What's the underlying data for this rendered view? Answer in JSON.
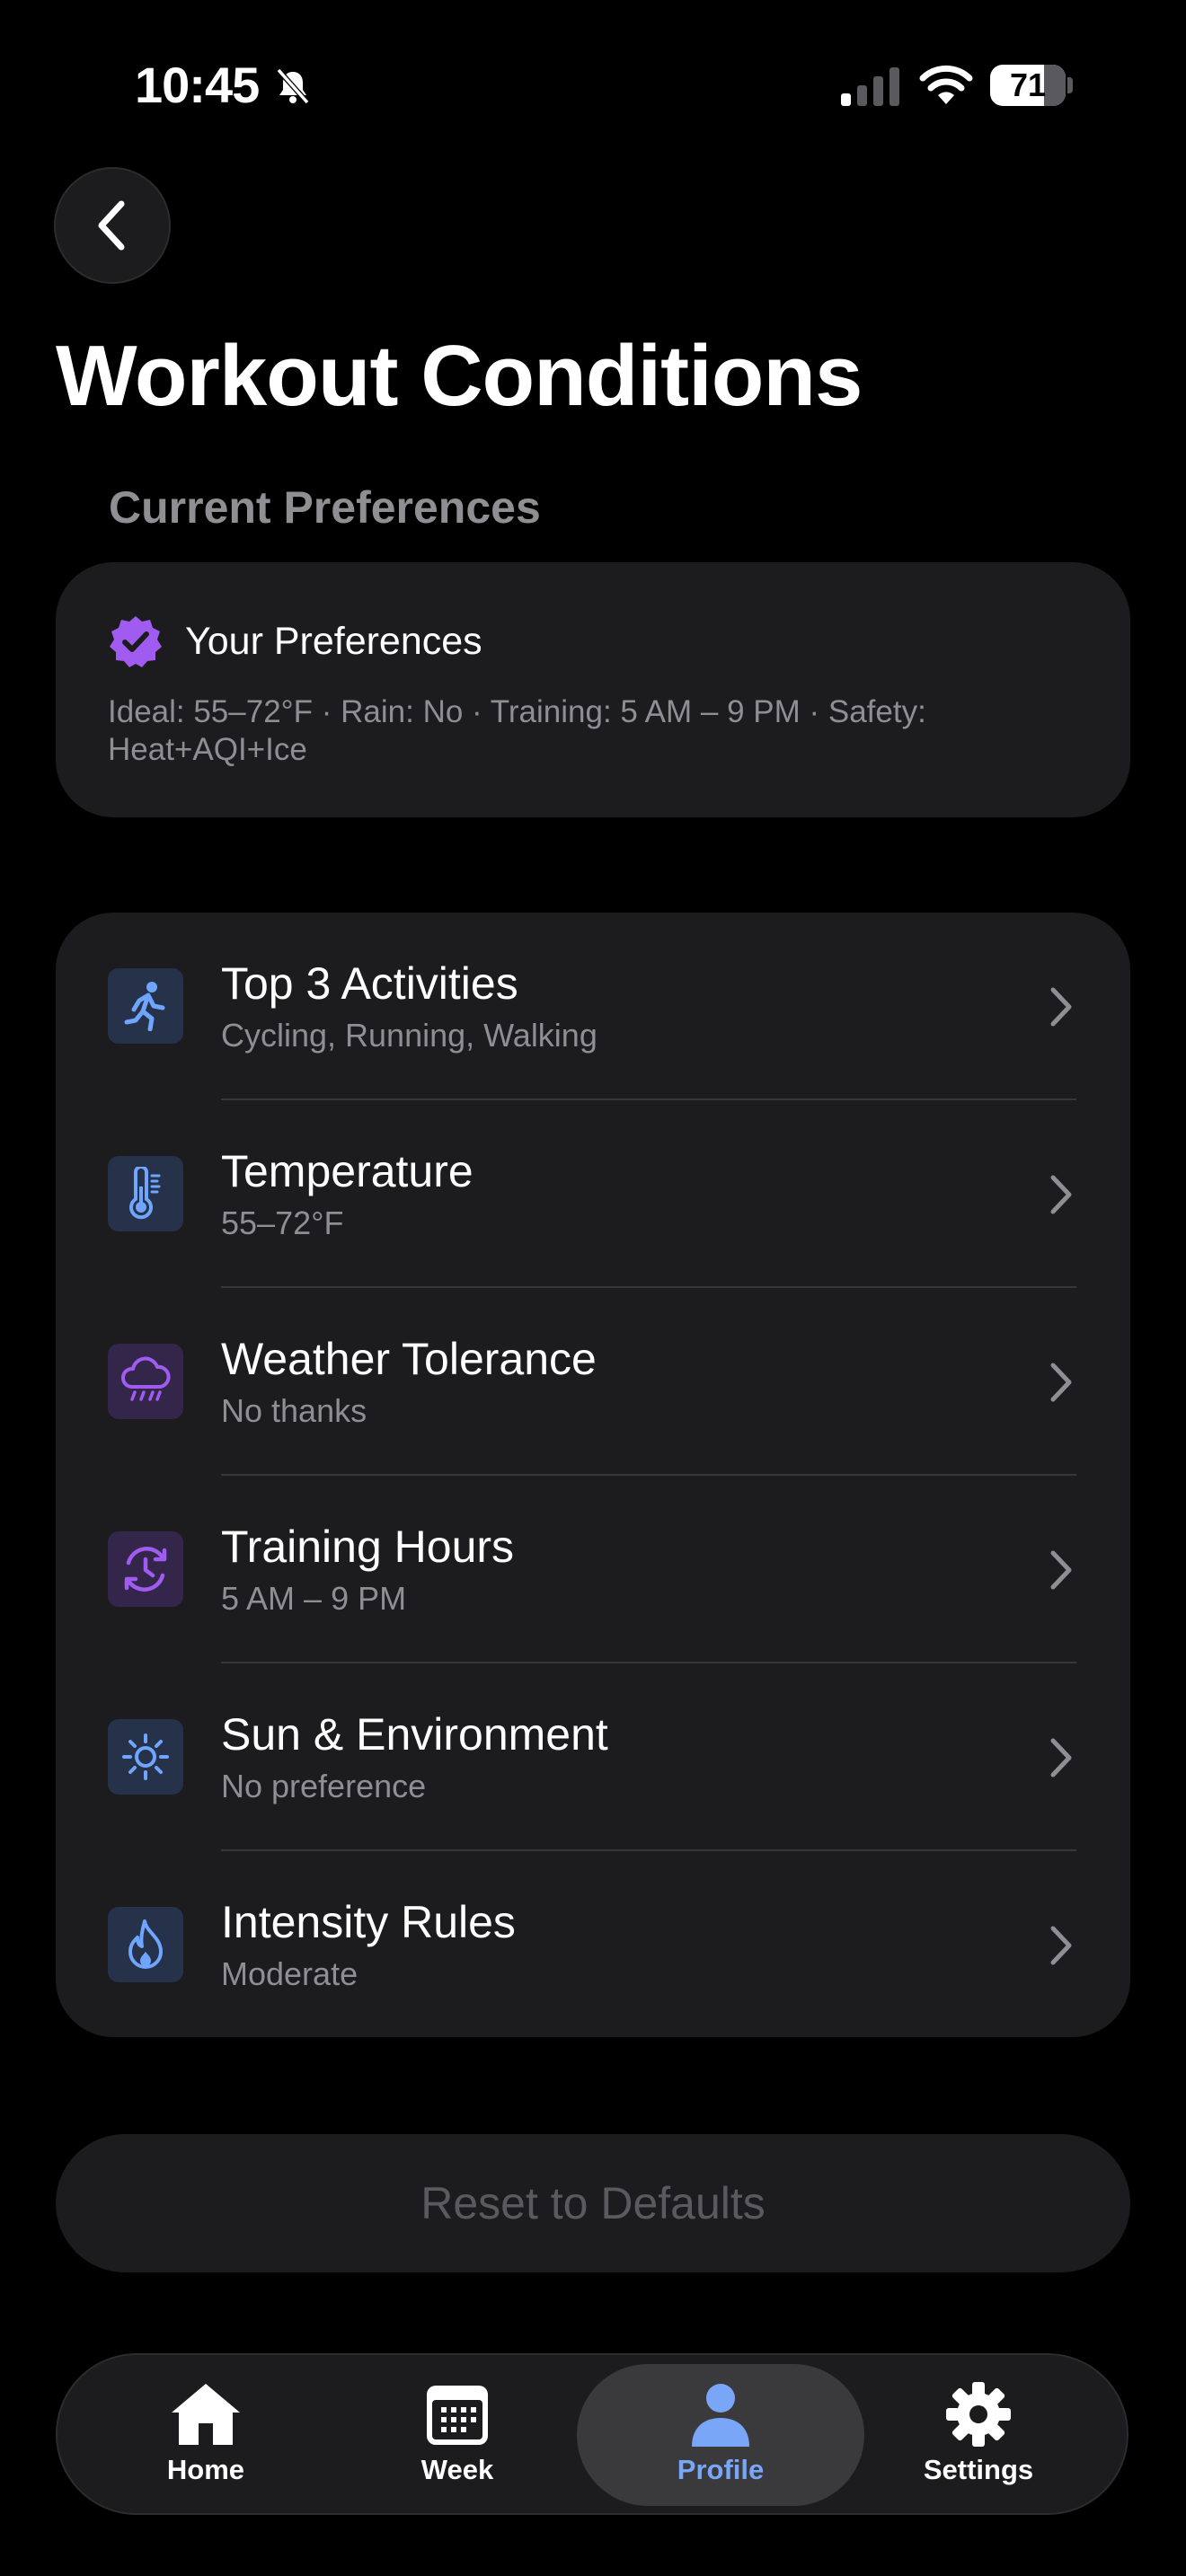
{
  "status_bar": {
    "time": "10:45",
    "battery": "71"
  },
  "header": {
    "title": "Workout Conditions"
  },
  "section": {
    "label": "Current Preferences"
  },
  "preferences_card": {
    "title": "Your Preferences",
    "summary": "Ideal: 55–72°F · Rain: No · Training: 5 AM – 9 PM · Safety: Heat+AQI+Ice"
  },
  "settings_list": [
    {
      "title": "Top 3 Activities",
      "subtitle": "Cycling, Running, Walking",
      "icon": "running-icon",
      "color": "#6fa5ff"
    },
    {
      "title": "Temperature",
      "subtitle": "55–72°F",
      "icon": "thermometer-icon",
      "color": "#6fa5ff"
    },
    {
      "title": "Weather Tolerance",
      "subtitle": "No thanks",
      "icon": "cloud-rain-icon",
      "color": "#a05cf0"
    },
    {
      "title": "Training Hours",
      "subtitle": "5 AM – 9 PM",
      "icon": "clock-icon",
      "color": "#a05cf0"
    },
    {
      "title": "Sun & Environment",
      "subtitle": "No preference",
      "icon": "sun-icon",
      "color": "#6fa5ff"
    },
    {
      "title": "Intensity Rules",
      "subtitle": "Moderate",
      "icon": "flame-icon",
      "color": "#6fa5ff"
    }
  ],
  "reset_button": {
    "label": "Reset to Defaults"
  },
  "tab_bar": {
    "tabs": [
      {
        "label": "Home",
        "icon": "home-icon"
      },
      {
        "label": "Week",
        "icon": "calendar-icon"
      },
      {
        "label": "Profile",
        "icon": "person-icon",
        "active": true
      },
      {
        "label": "Settings",
        "icon": "gear-icon"
      }
    ]
  },
  "colors": {
    "accent": "#7aa6f7",
    "purple": "#a05cf0",
    "card": "#1c1c1e",
    "muted": "#8e8e93"
  }
}
